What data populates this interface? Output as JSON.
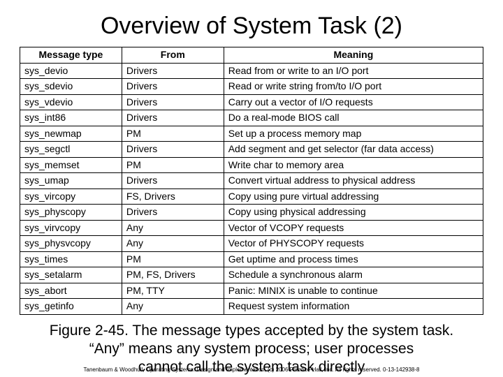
{
  "title": "Overview of System Task (2)",
  "columns": [
    "Message type",
    "From",
    "Meaning"
  ],
  "rows": [
    {
      "type": "sys_devio",
      "from": "Drivers",
      "meaning": "Read from or write to an I/O port"
    },
    {
      "type": "sys_sdevio",
      "from": "Drivers",
      "meaning": "Read or write string from/to I/O port"
    },
    {
      "type": "sys_vdevio",
      "from": "Drivers",
      "meaning": "Carry out a vector of I/O requests"
    },
    {
      "type": "sys_int86",
      "from": "Drivers",
      "meaning": "Do a real-mode BIOS call"
    },
    {
      "type": "sys_newmap",
      "from": "PM",
      "meaning": "Set up a process memory map"
    },
    {
      "type": "sys_segctl",
      "from": "Drivers",
      "meaning": "Add segment and get selector (far data access)"
    },
    {
      "type": "sys_memset",
      "from": "PM",
      "meaning": "Write char to memory area"
    },
    {
      "type": "sys_umap",
      "from": "Drivers",
      "meaning": "Convert virtual address to physical address"
    },
    {
      "type": "sys_vircopy",
      "from": "FS, Drivers",
      "meaning": "Copy using pure virtual addressing"
    },
    {
      "type": "sys_physcopy",
      "from": "Drivers",
      "meaning": "Copy using physical addressing"
    },
    {
      "type": "sys_virvcopy",
      "from": "Any",
      "meaning": "Vector of VCOPY requests"
    },
    {
      "type": "sys_physvcopy",
      "from": "Any",
      "meaning": "Vector of PHYSCOPY requests"
    },
    {
      "type": "sys_times",
      "from": "PM",
      "meaning": "Get uptime and process times"
    },
    {
      "type": "sys_setalarm",
      "from": "PM, FS, Drivers",
      "meaning": "Schedule a synchronous alarm"
    },
    {
      "type": "sys_abort",
      "from": "PM, TTY",
      "meaning": "Panic: MINIX is unable to continue"
    },
    {
      "type": "sys_getinfo",
      "from": "Any",
      "meaning": "Request system information"
    }
  ],
  "caption_line1": "Figure 2-45.  The message types accepted by the system task.",
  "caption_line2": "“Any” means any system process; user processes",
  "caption_line3": "cannot call the system task directly",
  "footer": "Tanenbaum & Woodhull, Operating Systems: Design and Implementation, (c) 2006 Prentice-Hall, Inc. All rights reserved. 0-13-142938-8"
}
